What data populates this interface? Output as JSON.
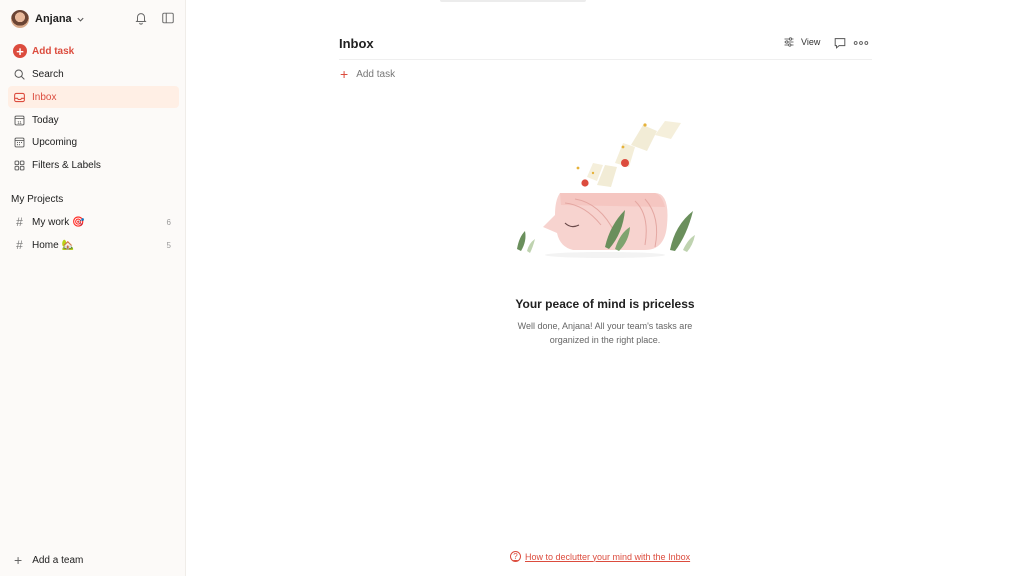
{
  "user": {
    "name": "Anjana"
  },
  "sidebar": {
    "add_task": "Add task",
    "nav": [
      {
        "label": "Search",
        "icon": "search-icon"
      },
      {
        "label": "Inbox",
        "icon": "inbox-icon"
      },
      {
        "label": "Today",
        "icon": "today-icon"
      },
      {
        "label": "Upcoming",
        "icon": "calendar-icon"
      },
      {
        "label": "Filters & Labels",
        "icon": "grid-icon"
      }
    ],
    "projects_heading": "My Projects",
    "projects": [
      {
        "label": "My work 🎯",
        "count": "6"
      },
      {
        "label": "Home 🏡",
        "count": "5"
      }
    ],
    "add_team": "Add a team"
  },
  "main": {
    "title": "Inbox",
    "view_label": "View",
    "add_task": "Add task",
    "empty_title": "Your peace of mind is priceless",
    "empty_desc": "Well done, Anjana! All your team's tasks are organized in the right place.",
    "help_link": "How to declutter your mind with the Inbox"
  },
  "colors": {
    "accent": "#dc4c3e",
    "active_bg": "#ffefe5",
    "sidebar_bg": "#fcfaf8"
  }
}
